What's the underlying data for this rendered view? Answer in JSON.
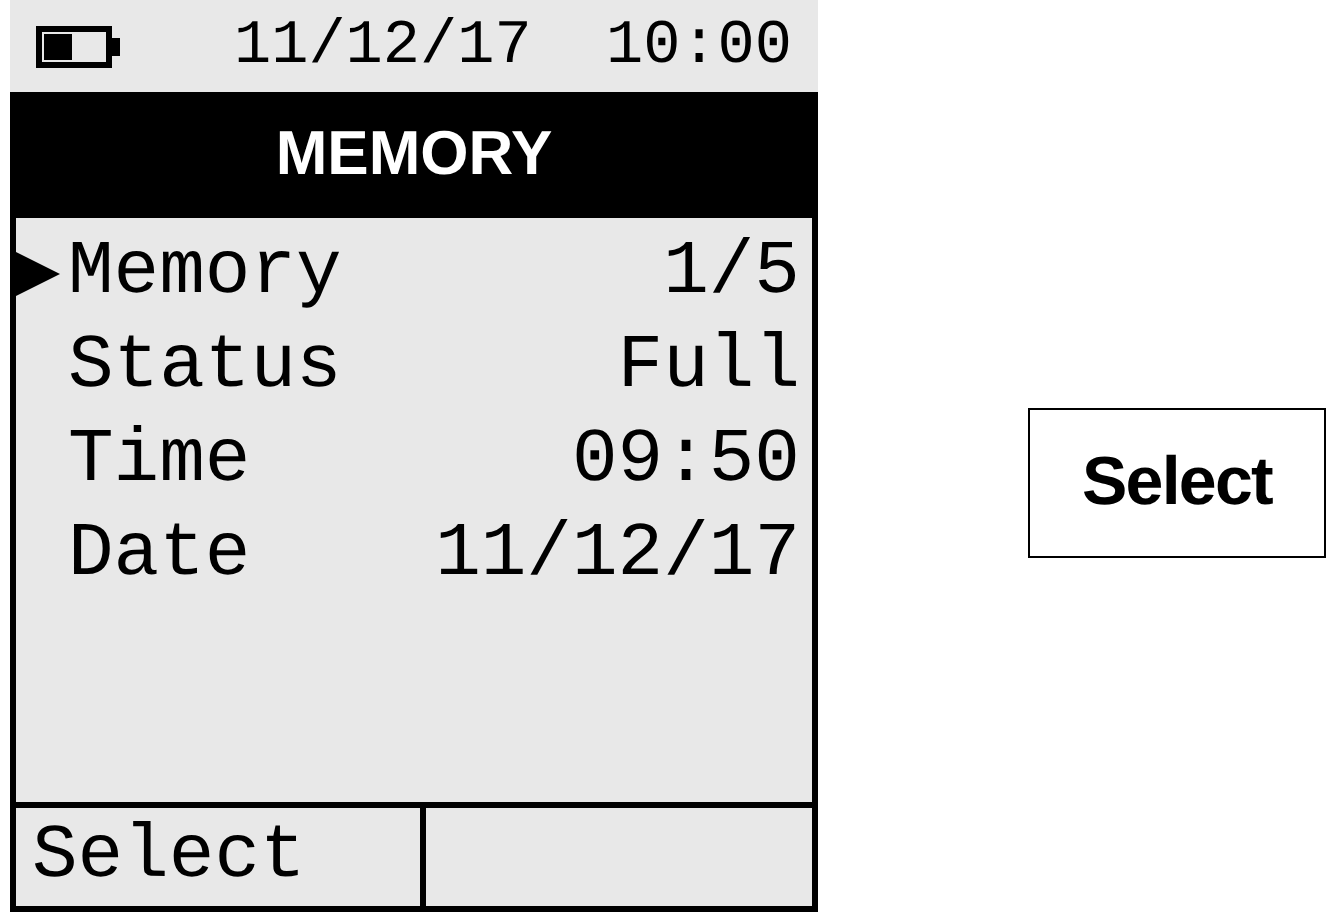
{
  "status_bar": {
    "date": "11/12/17",
    "time": "10:00"
  },
  "title": "MEMORY",
  "menu": {
    "rows": [
      {
        "label": "Memory",
        "value": "1/5",
        "selected": true
      },
      {
        "label": "Status",
        "value": "Full",
        "selected": false
      },
      {
        "label": "Time",
        "value": "09:50",
        "selected": false
      },
      {
        "label": "Date",
        "value": "11/12/17",
        "selected": false
      }
    ]
  },
  "soft_keys": {
    "left": "Select"
  },
  "button": "Select"
}
